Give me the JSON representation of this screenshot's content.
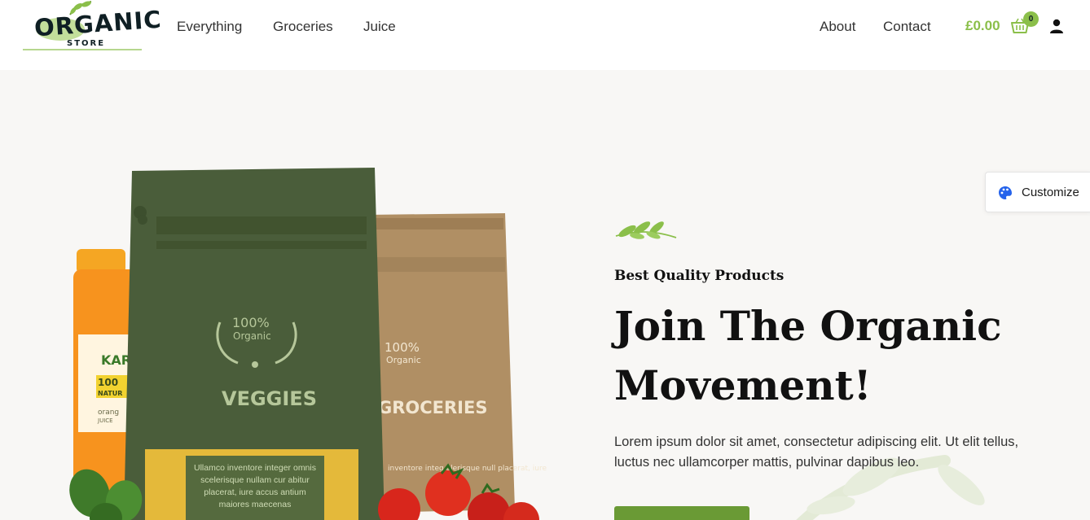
{
  "header": {
    "logo": {
      "word": "ORGANIC",
      "sub": "STORE"
    },
    "nav": [
      {
        "label": "Everything"
      },
      {
        "label": "Groceries"
      },
      {
        "label": "Juice"
      }
    ],
    "right_nav": [
      {
        "label": "About"
      },
      {
        "label": "Contact"
      }
    ],
    "cart": {
      "amount": "£0.00",
      "count": "0",
      "icon": "basket-icon"
    },
    "user_icon": "user-icon",
    "accent_color": "#8bbf4a"
  },
  "hero": {
    "eyebrow": "Best Quality Products",
    "headline_line1": "Join The Organic",
    "headline_line2": "Movement!",
    "body": "Lorem ipsum dolor sit amet, consectetur adipiscing elit. Ut elit tellus, luctus nec ullamcorper mattis, pulvinar dapibus leo.",
    "cta_label": "",
    "button_color": "#6a9a35",
    "background": "#f8f7f5",
    "packs": {
      "green": {
        "badge_top": "100%",
        "badge_bottom": "Organic",
        "name": "VEGGIES",
        "window_text": "Ullamco inventore integer omnis scelerisque nullam cur abitur placerat, iure accus antium maiores maecenas"
      },
      "kraft": {
        "badge_top": "100%",
        "badge_bottom": "Organic",
        "name": "GROCERIES",
        "window_text": "inventore integ elerisque null placerat, iure"
      },
      "jar": {
        "brand": "KAR",
        "badge": "100",
        "badge_sub": "NATUR",
        "flavour": "orang",
        "flavour_sub": "JUICE"
      }
    }
  },
  "customize": {
    "label": "Customize",
    "icon": "palette-icon"
  }
}
